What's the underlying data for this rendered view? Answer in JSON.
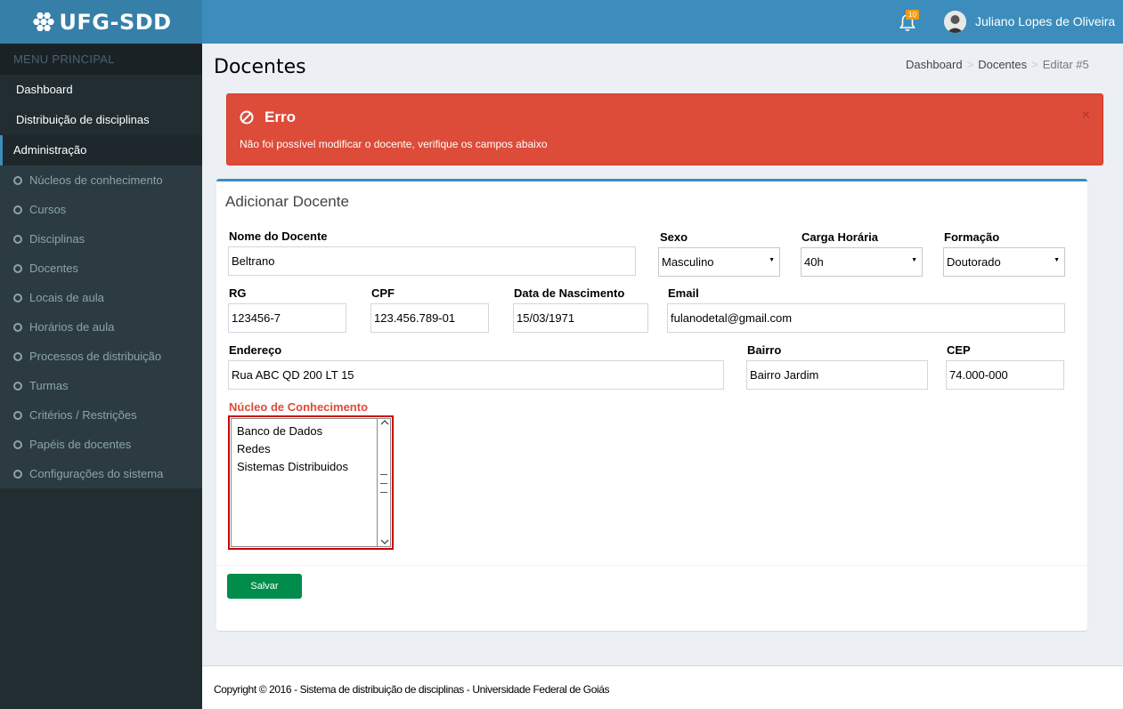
{
  "app": {
    "logo_text": "UFG-SDD"
  },
  "header": {
    "notification_count": "10",
    "user_name": "Juliano Lopes de Oliveira"
  },
  "sidebar": {
    "menu_header": "MENU PRINCIPAL",
    "top_items": [
      "Dashboard",
      "Distribuição de disciplinas",
      "Administração"
    ],
    "sub_items": [
      "Núcleos de conhecimento",
      "Cursos",
      "Disciplinas",
      "Docentes",
      "Locais de aula",
      "Horários de aula",
      "Processos de distribuição",
      "Turmas",
      "Critérios / Restrições",
      "Papéis de docentes",
      "Configurações do sistema"
    ]
  },
  "page": {
    "title": "Docentes",
    "breadcrumb": [
      "Dashboard",
      "Docentes",
      "Editar #5"
    ]
  },
  "alert": {
    "title": "Erro",
    "message": "Não foi possível modificar o docente, verifique os campos abaixo",
    "close": "×"
  },
  "form": {
    "box_title": "Adicionar Docente",
    "nome": {
      "label": "Nome do Docente",
      "value": "Beltrano"
    },
    "sexo": {
      "label": "Sexo",
      "value": "Masculino"
    },
    "carga": {
      "label": "Carga Horária",
      "value": "40h"
    },
    "formacao": {
      "label": "Formação",
      "value": "Doutorado"
    },
    "rg": {
      "label": "RG",
      "value": "123456-7"
    },
    "cpf": {
      "label": "CPF",
      "value": "123.456.789-01"
    },
    "nascimento": {
      "label": "Data de Nascimento",
      "value": "15/03/1971"
    },
    "email": {
      "label": "Email",
      "value": "fulanodetal@gmail.com"
    },
    "endereco": {
      "label": "Endereço",
      "value": "Rua ABC QD 200 LT 15"
    },
    "bairro": {
      "label": "Bairro",
      "value": "Bairro Jardim"
    },
    "cep": {
      "label": "CEP",
      "value": "74.000-000"
    },
    "nucleo": {
      "label": "Núcleo de Conhecimento",
      "options": [
        "Banco de Dados",
        "Redes",
        "Sistemas Distribuidos"
      ]
    },
    "save_label": "Salvar"
  },
  "footer": {
    "text": "Copyright © 2016 - Sistema de distribuição de disciplinas - Universidade Federal de Goiás"
  },
  "colors": {
    "primary": "#3c8dbc",
    "danger": "#dd4b39",
    "success": "#008d4c",
    "sidebar": "#222d32"
  }
}
